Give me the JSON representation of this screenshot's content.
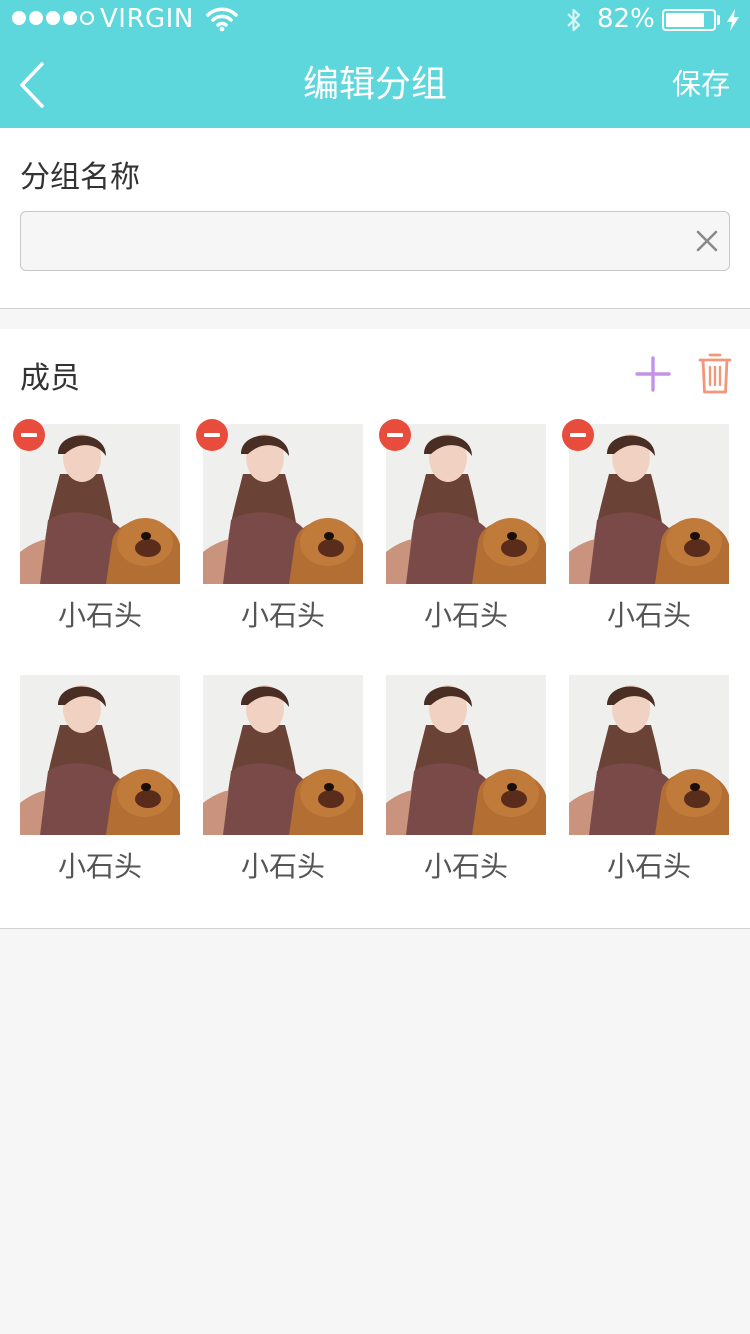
{
  "status_bar": {
    "carrier": "VIRGIN",
    "signal_bars": 4,
    "battery_percent": "82%",
    "battery_level": 0.82,
    "icons": [
      "signal-dots-icon",
      "wifi-icon",
      "bluetooth-icon",
      "battery-icon",
      "charging-bolt-icon"
    ]
  },
  "nav": {
    "title": "编辑分组",
    "save_label": "保存",
    "back_icon": "chevron-left-icon"
  },
  "group_name": {
    "label": "分组名称",
    "input_value": "",
    "clear_icon": "close-icon"
  },
  "members": {
    "label": "成员",
    "add_icon": "plus-icon",
    "delete_icon": "trash-icon",
    "items": [
      {
        "name": "小石头",
        "removable": true
      },
      {
        "name": "小石头",
        "removable": true
      },
      {
        "name": "小石头",
        "removable": true
      },
      {
        "name": "小石头",
        "removable": true
      },
      {
        "name": "小石头",
        "removable": false
      },
      {
        "name": "小石头",
        "removable": false
      },
      {
        "name": "小石头",
        "removable": false
      },
      {
        "name": "小石头",
        "removable": false
      }
    ]
  },
  "colors": {
    "header": "#5dd6dc",
    "add": "#c493e9",
    "delete": "#f2977a",
    "remove_badge": "#e74c3c",
    "background": "#f6f6f6"
  }
}
